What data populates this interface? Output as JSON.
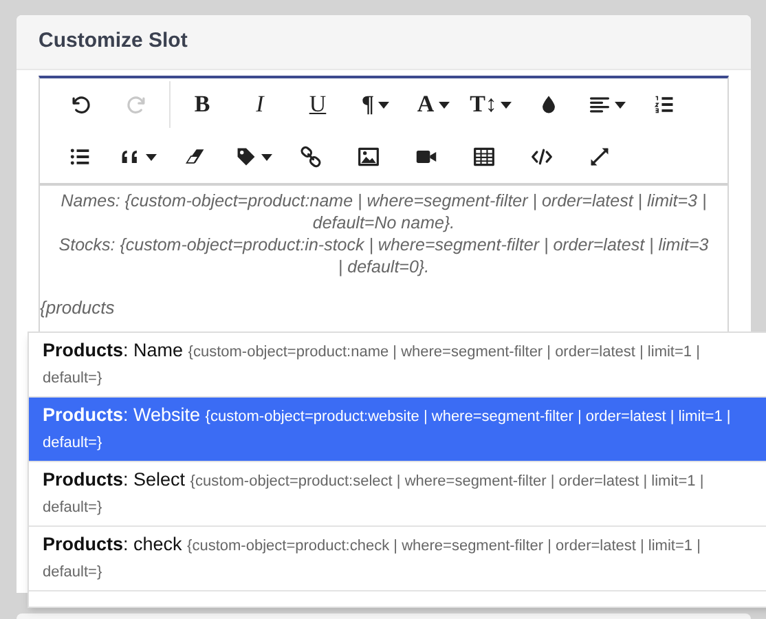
{
  "panel": {
    "title": "Customize Slot"
  },
  "toolbar": {
    "rows": [
      [
        {
          "kind": "undo",
          "disabled": false
        },
        {
          "kind": "redo",
          "disabled": true
        },
        {
          "kind": "separator"
        },
        {
          "kind": "bold",
          "label": "B"
        },
        {
          "kind": "italic",
          "label": "I"
        },
        {
          "kind": "underline",
          "label": "U"
        },
        {
          "kind": "paragraph",
          "label": "¶",
          "dropdown": true
        },
        {
          "kind": "font",
          "label": "A",
          "dropdown": true
        },
        {
          "kind": "size",
          "label": "T↕",
          "dropdown": true
        },
        {
          "kind": "drop"
        },
        {
          "kind": "align",
          "dropdown": true
        },
        {
          "kind": "ordered-list"
        }
      ],
      [
        {
          "kind": "bullet-list"
        },
        {
          "kind": "quote",
          "dropdown": true
        },
        {
          "kind": "eraser"
        },
        {
          "kind": "tag",
          "dropdown": true
        },
        {
          "kind": "link"
        },
        {
          "kind": "image"
        },
        {
          "kind": "video"
        },
        {
          "kind": "table"
        },
        {
          "kind": "code"
        },
        {
          "kind": "expand"
        }
      ]
    ]
  },
  "content": {
    "paragraphs": [
      "Names: {custom-object=product:name | where=segment-filter | order=latest | limit=3 | default=No name}.",
      "Stocks: {custom-object=product:in-stock | where=segment-filter | order=latest | limit=3 | default=0}."
    ],
    "typed": "{products"
  },
  "suggestions": [
    {
      "label": "**Products**: Name",
      "tag": "{custom-object=product:name | where=segment-filter | order=latest | limit=1 | default=}",
      "selected": false
    },
    {
      "label": "**Products**: Website",
      "tag": "{custom-object=product:website | where=segment-filter | order=latest | limit=1 | default=}",
      "selected": true
    },
    {
      "label": "**Products**: Select",
      "tag": "{custom-object=product:select | where=segment-filter | order=latest | limit=1 | default=}",
      "selected": false
    },
    {
      "label": "**Products**: check",
      "tag": "{custom-object=product:check | where=segment-filter | order=latest | limit=1 | default=}",
      "selected": false
    }
  ]
}
